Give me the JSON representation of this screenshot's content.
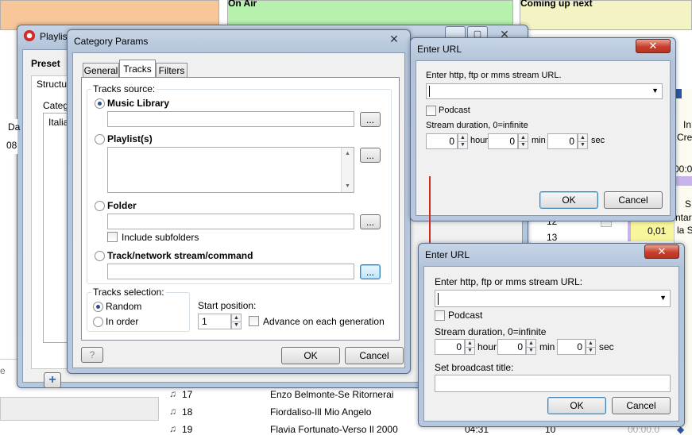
{
  "background": {
    "strip_on_air": "On Air",
    "strip_coming_up": "Coming up next",
    "playlist_rows": [
      {
        "num": "17",
        "title": "Enzo Belmonte-Se Ritornerai",
        "dur": "",
        "pos": ""
      },
      {
        "num": "18",
        "title": "Fiordaliso-Ill Mio Angelo",
        "dur": "",
        "pos": ""
      },
      {
        "num": "19",
        "title": "Flavia Fortunato-Verso Il 2000",
        "dur": "04:31",
        "pos": "10"
      }
    ],
    "mid_numbers": [
      "12",
      "13"
    ],
    "right_value": "0,01",
    "right_text_1": "In",
    "right_text_2": "Cre",
    "right_text_3": "00:0",
    "right_text_4": "S",
    "right_text_5": "ntar",
    "right_text_6": "la S",
    "right_bottom": "00:00.0",
    "left_fragments": {
      "da": "Da",
      "n08": "08",
      "e": "e"
    }
  },
  "playlist_window": {
    "title": "Playlis",
    "preset_label": "Preset",
    "structure_label": "Structur",
    "category_label": "Catego",
    "list_item": "Italia",
    "add_button": "+"
  },
  "category_params": {
    "title": "Category Params",
    "close": "✕",
    "tabs": [
      "General",
      "Tracks",
      "Filters"
    ],
    "tracks_source_label": "Tracks source:",
    "music_library": "Music Library",
    "playlists": "Playlist(s)",
    "folder": "Folder",
    "include_subfolders": "Include subfolders",
    "track_stream": "Track/network stream/command",
    "ellipsis": "...",
    "tracks_selection_label": "Tracks selection:",
    "random": "Random",
    "in_order": "In order",
    "start_position_label": "Start position:",
    "start_position_value": "1",
    "advance": "Advance on each generation",
    "help": "?",
    "ok": "OK",
    "cancel": "Cancel"
  },
  "enter_url_top": {
    "title": "Enter URL",
    "close": "✕",
    "prompt": "Enter http, ftp or mms stream URL.",
    "url_value": "",
    "podcast": "Podcast",
    "duration_label": "Stream duration, 0=infinite",
    "hour_value": "0",
    "hour": "hour",
    "min_value": "0",
    "min": "min",
    "sec_value": "0",
    "sec": "sec",
    "ok": "OK",
    "cancel": "Cancel"
  },
  "enter_url_bottom": {
    "title": "Enter URL",
    "close": "✕",
    "prompt": "Enter http, ftp or mms stream URL:",
    "url_value": "",
    "podcast": "Podcast",
    "duration_label": "Stream duration, 0=infinite",
    "hour_value": "0",
    "hour": "hour",
    "min_value": "0",
    "min": "min",
    "sec_value": "0",
    "sec": "sec",
    "broadcast_label": "Set broadcast title:",
    "broadcast_value": "",
    "ok": "OK",
    "cancel": "Cancel"
  },
  "colors": {
    "on_air": "#b6f2ae",
    "coming_up": "#f3f3c4",
    "left_strip": "#f7c79a",
    "arrow": "#d12a20",
    "highlight_yellow": "#f8f59a",
    "highlight_purple": "#c8b4ea"
  }
}
